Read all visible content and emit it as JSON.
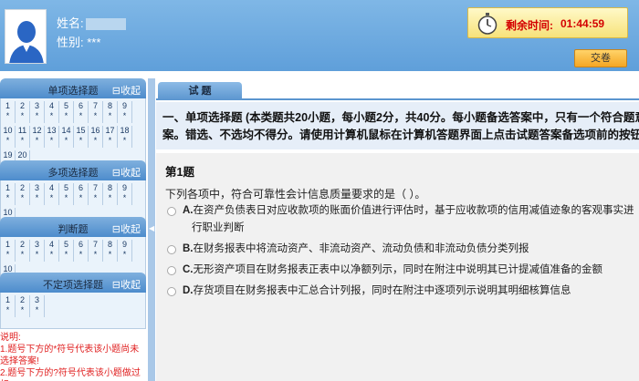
{
  "header": {
    "name_label": "姓名:",
    "gender_label": "性别:",
    "gender_value": "***",
    "timer_label": "剩余时间:",
    "timer_value": "01:44:59",
    "submit_label": "交卷"
  },
  "sidebar": {
    "sections": [
      {
        "title": "单项选择题",
        "collapse": "收起",
        "numbers": [
          "1",
          "2",
          "3",
          "4",
          "5",
          "6",
          "7",
          "8",
          "9",
          "10",
          "11",
          "12",
          "13",
          "14",
          "15",
          "16",
          "17",
          "18",
          "19",
          "20"
        ],
        "mark": "*"
      },
      {
        "title": "多项选择题",
        "collapse": "收起",
        "numbers": [
          "1",
          "2",
          "3",
          "4",
          "5",
          "6",
          "7",
          "8",
          "9",
          "10"
        ],
        "mark": "*"
      },
      {
        "title": "判断题",
        "collapse": "收起",
        "numbers": [
          "1",
          "2",
          "3",
          "4",
          "5",
          "6",
          "7",
          "8",
          "9",
          "10"
        ],
        "mark": "*"
      },
      {
        "title": "不定项选择题",
        "collapse": "收起",
        "numbers": [
          "1",
          "2",
          "3"
        ],
        "mark": "*"
      }
    ],
    "notes": [
      "说明:",
      "1.题号下方的*符号代表该小题尚未选择答案!",
      "2.题号下方的?符号代表该小题做过标"
    ]
  },
  "main": {
    "tab_label": "试 题",
    "section_header_line1": "一、单项选择题 (本类题共20小题，每小题2分，共40分。每小题备选答案中，只有一个符合题意的正确答",
    "section_header_line2": "案。错选、不选均不得分。请使用计算机鼠标在计算机答题界面上点击试题答案备选项前的按钮\"○\"作答。)",
    "question_number": "第1题",
    "question_stem": "下列各项中，符合可靠性会计信息质量要求的是（   ）。",
    "options": [
      {
        "letter": "A.",
        "text": "在资产负债表日对应收款项的账面价值进行评估时，基于应收款项的信用减值迹象的客观事实进",
        "text_cont": "行职业判断"
      },
      {
        "letter": "B.",
        "text": "在财务报表中将流动资产、非流动资产、流动负债和非流动负债分类列报"
      },
      {
        "letter": "C.",
        "text": "无形资产项目在财务报表正表中以净额列示，同时在附注中说明其已计提减值准备的金额"
      },
      {
        "letter": "D.",
        "text": "存货项目在财务报表中汇总合计列报，同时在附注中逐项列示说明其明细核算信息"
      }
    ]
  },
  "colors": {
    "timer_text": "#d40000",
    "notes_text": "#e02020",
    "header_bg": "#6aa8de"
  }
}
